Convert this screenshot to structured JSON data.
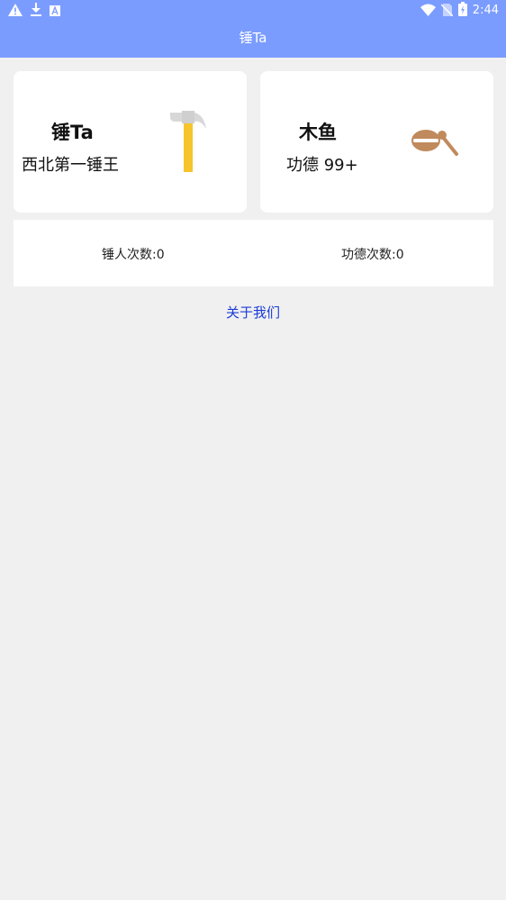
{
  "status_bar": {
    "time": "2:44",
    "left_icons": [
      "warning-icon",
      "download-icon",
      "font-icon"
    ],
    "right_icons": [
      "wifi-icon",
      "no-sim-icon",
      "battery-icon"
    ]
  },
  "app_bar": {
    "title": "锤Ta",
    "color": "#7b9cff"
  },
  "cards": [
    {
      "title": "锤Ta",
      "subtitle": "西北第一锤王",
      "icon": "hammer-icon"
    },
    {
      "title": "木鱼",
      "subtitle": "功德 99+",
      "icon": "wooden-fish-icon"
    }
  ],
  "stats": {
    "hammer_label": "锤人次数:0",
    "merit_label": "功德次数:0"
  },
  "about_link": "关于我们",
  "colors": {
    "background": "#f0f0f0",
    "link": "#1a3bd6",
    "hammer_handle": "#f5c52b",
    "hammer_head": "#d8d8d8",
    "fish": "#c08a5c"
  }
}
